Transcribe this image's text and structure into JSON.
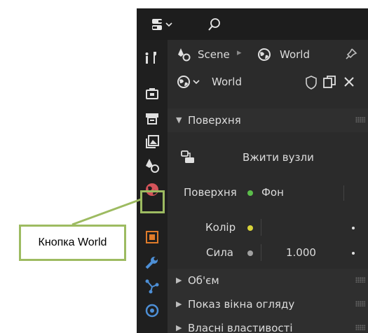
{
  "header": {
    "breadcrumb_scene": "Scene",
    "breadcrumb_world": "World",
    "pin_icon": "pin-icon"
  },
  "datablock": {
    "name": "World"
  },
  "surface_panel": {
    "title": "Поверхня",
    "use_nodes_label": "Вжити вузли",
    "surface_label": "Поверхня",
    "surface_value": "Фон",
    "color_label": "Колір",
    "strength_label": "Сила",
    "strength_value": "1.000",
    "socket_green": "#5bbd4a",
    "socket_yellow": "#d8d33a",
    "socket_gray": "#a0a0a0"
  },
  "collapsed_panels": [
    {
      "title": "Об'єм"
    },
    {
      "title": "Показ вікна огляду"
    },
    {
      "title": "Власні властивості"
    }
  ],
  "callout": {
    "label": "Кнопка World",
    "color": "#9dbb61"
  },
  "tabs": [
    "tool-icon",
    "render-icon",
    "output-icon",
    "view-layer-icon",
    "scene-icon",
    "world-icon",
    "object-icon",
    "modifier-icon",
    "particles-icon",
    "physics-icon"
  ]
}
